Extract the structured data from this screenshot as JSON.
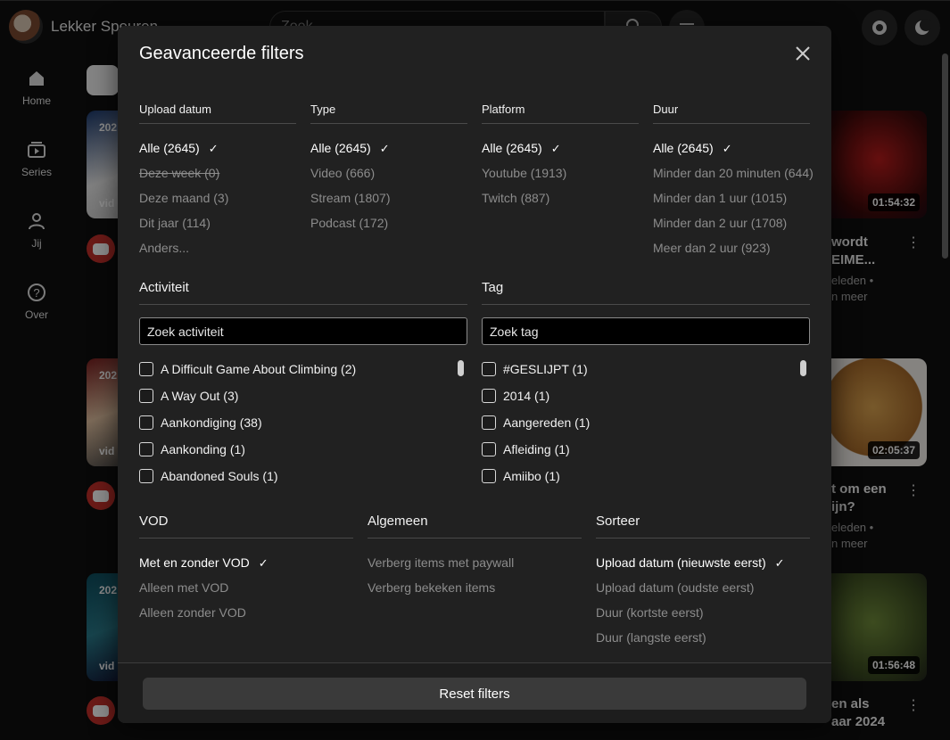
{
  "app": {
    "title": "Lekker Speuren",
    "search_placeholder": "Zoek"
  },
  "sidebar": {
    "items": [
      {
        "label": "Home",
        "icon": "home-icon"
      },
      {
        "label": "Series",
        "icon": "series-icon"
      },
      {
        "label": "Jij",
        "icon": "user-icon"
      },
      {
        "label": "Over",
        "icon": "help-icon"
      }
    ]
  },
  "background": {
    "durations": [
      "01:54:32",
      "02:05:37",
      "01:56:48"
    ],
    "badges": [
      "202",
      "202",
      "202"
    ],
    "vid_labels": [
      "vid",
      "vid",
      "vid"
    ],
    "titles": [
      {
        "l1": "wordt",
        "l2": "EIME..."
      },
      {
        "l1": "t om een",
        "l2": "ijn?"
      },
      {
        "l1": "en als",
        "l2": "aar 2024"
      }
    ],
    "meta": [
      {
        "l1": "eleden •",
        "l2": "n meer"
      },
      {
        "l1": "eleden •",
        "l2": "n meer"
      }
    ]
  },
  "dialog": {
    "title": "Geavanceerde filters",
    "upload": {
      "heading": "Upload datum",
      "options": [
        {
          "label": "Alle (2645)",
          "selected": true
        },
        {
          "label": "Deze week (0)",
          "disabled": true
        },
        {
          "label": "Deze maand (3)"
        },
        {
          "label": "Dit jaar (114)"
        },
        {
          "label": "Anders..."
        }
      ]
    },
    "type": {
      "heading": "Type",
      "options": [
        {
          "label": "Alle (2645)",
          "selected": true
        },
        {
          "label": "Video (666)"
        },
        {
          "label": "Stream (1807)"
        },
        {
          "label": "Podcast (172)"
        }
      ]
    },
    "platform": {
      "heading": "Platform",
      "options": [
        {
          "label": "Alle (2645)",
          "selected": true
        },
        {
          "label": "Youtube (1913)"
        },
        {
          "label": "Twitch (887)"
        }
      ]
    },
    "duration": {
      "heading": "Duur",
      "options": [
        {
          "label": "Alle (2645)",
          "selected": true
        },
        {
          "label": "Minder dan 20 minuten (644)"
        },
        {
          "label": "Minder dan 1 uur (1015)"
        },
        {
          "label": "Minder dan 2 uur (1708)"
        },
        {
          "label": "Meer dan 2 uur (923)"
        }
      ]
    },
    "activity": {
      "heading": "Activiteit",
      "placeholder": "Zoek activiteit",
      "items": [
        "A Difficult Game About Climbing (2)",
        "A Way Out (3)",
        "Aankondiging (38)",
        "Aankonding (1)",
        "Abandoned Souls (1)"
      ]
    },
    "tag": {
      "heading": "Tag",
      "placeholder": "Zoek tag",
      "items": [
        "#GESLIJPT (1)",
        "2014 (1)",
        "Aangereden (1)",
        "Afleiding (1)",
        "Amiibo (1)"
      ]
    },
    "vod": {
      "heading": "VOD",
      "options": [
        {
          "label": "Met en zonder VOD",
          "selected": true
        },
        {
          "label": "Alleen met VOD"
        },
        {
          "label": "Alleen zonder VOD"
        }
      ]
    },
    "general": {
      "heading": "Algemeen",
      "options": [
        {
          "label": "Verberg items met paywall"
        },
        {
          "label": "Verberg bekeken items"
        }
      ]
    },
    "sort": {
      "heading": "Sorteer",
      "options": [
        {
          "label": "Upload datum (nieuwste eerst)",
          "selected": true
        },
        {
          "label": "Upload datum (oudste eerst)"
        },
        {
          "label": "Duur (kortste eerst)"
        },
        {
          "label": "Duur (langste eerst)"
        }
      ]
    },
    "reset_label": "Reset filters",
    "check_glyph": "✓"
  }
}
